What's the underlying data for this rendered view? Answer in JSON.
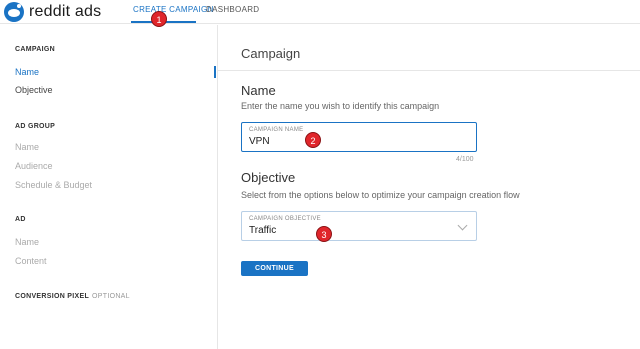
{
  "brand": {
    "logo_text": "reddit ads",
    "accent": "#1a73c4"
  },
  "nav": {
    "create_campaign": "CREATE CAMPAIGN",
    "dashboard": "DASHBOARD"
  },
  "sidebar": {
    "campaign": {
      "title": "CAMPAIGN",
      "items": [
        "Name",
        "Objective"
      ]
    },
    "ad_group": {
      "title": "AD GROUP",
      "items": [
        "Name",
        "Audience",
        "Schedule & Budget"
      ]
    },
    "ad": {
      "title": "AD",
      "items": [
        "Name",
        "Content"
      ]
    },
    "conversion_pixel": {
      "title": "CONVERSION PIXEL",
      "optional": "OPTIONAL"
    }
  },
  "main": {
    "title": "Campaign",
    "name_section": {
      "heading": "Name",
      "description": "Enter the name you wish to identify this campaign",
      "field_label": "CAMPAIGN NAME",
      "field_value": "VPN",
      "counter": "4/100"
    },
    "objective_section": {
      "heading": "Objective",
      "description": "Select from the options below to optimize your campaign creation flow",
      "field_label": "CAMPAIGN OBJECTIVE",
      "field_value": "Traffic"
    },
    "continue_label": "CONTINUE"
  },
  "annotations": {
    "badge_1": "1",
    "badge_2": "2",
    "badge_3": "3",
    "color": "#e0262b"
  }
}
